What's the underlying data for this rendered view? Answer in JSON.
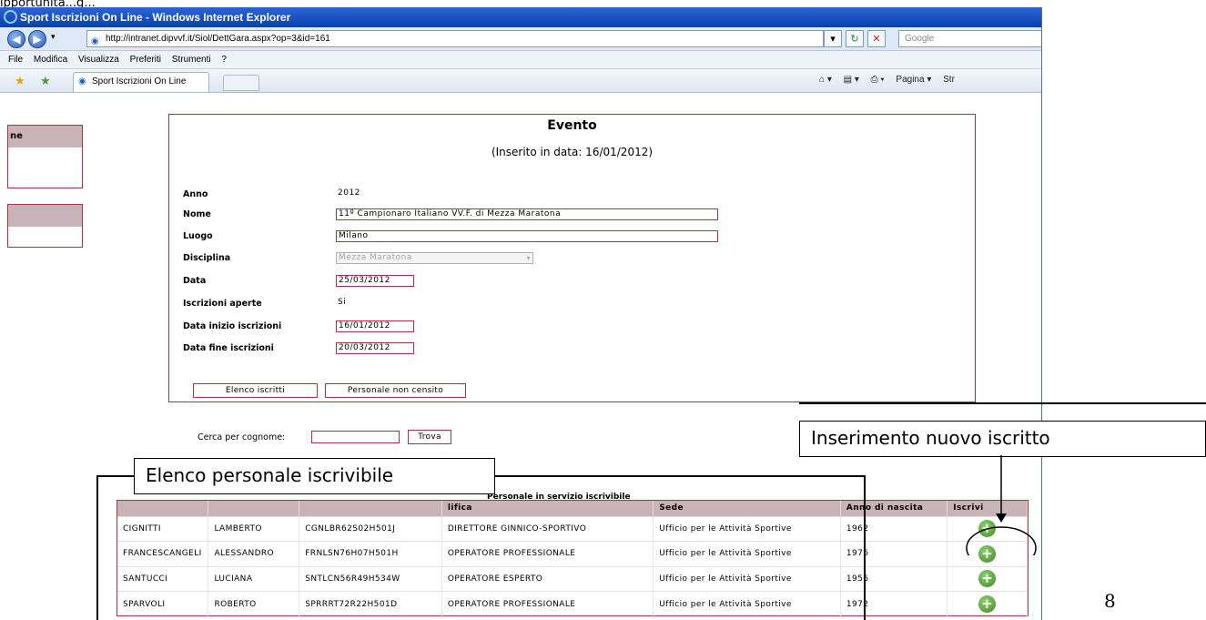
{
  "top_clip_text": "ipportunita...g...",
  "browser": {
    "title": "Sport Iscrizioni On Line - Windows Internet Explorer",
    "address": "http://intranet.dipvvf.it/Siol/DettGara.aspx?op=3&id=161",
    "search_placeholder": "Google",
    "menu": [
      "File",
      "Modifica",
      "Visualizza",
      "Preferiti",
      "Strumenti",
      "?"
    ],
    "tab_label": "Sport Iscrizioni On Line",
    "commands": [
      "Pagina ▾",
      "Str"
    ]
  },
  "sidebar": {
    "box1_header": "ne"
  },
  "event": {
    "title": "Evento",
    "inserted": "(Inserito in data: 16/01/2012)",
    "fields": {
      "anno": {
        "label": "Anno",
        "value": "2012"
      },
      "nome": {
        "label": "Nome",
        "value": "11º Campionaro Italiano VV.F. di Mezza Maratona"
      },
      "luogo": {
        "label": "Luogo",
        "value": "Milano"
      },
      "disciplina": {
        "label": "Disciplina",
        "value": "Mezza Maratona"
      },
      "data": {
        "label": "Data",
        "value": "25/03/2012"
      },
      "iscrizioni_aperte": {
        "label": "Iscrizioni aperte",
        "value": "Si"
      },
      "data_inizio": {
        "label": "Data inizio iscrizioni",
        "value": "16/01/2012"
      },
      "data_fine": {
        "label": "Data fine iscrizioni",
        "value": "20/03/2012"
      }
    },
    "buttons": {
      "elenco": "Elenco iscritti",
      "personale": "Personale non censito"
    }
  },
  "search": {
    "label": "Cerca per cognome:",
    "value": "",
    "button": "Trova"
  },
  "grid": {
    "caption": "Personale in servizio iscrivibile",
    "headers": [
      "",
      "",
      "",
      "lifica",
      "Sede",
      "Anno di nascita",
      "Iscrivi"
    ],
    "rows": [
      [
        "CIGNITTI",
        "LAMBERTO",
        "CGNLBR62S02H501J",
        "DIRETTORE GINNICO-SPORTIVO",
        "Ufficio per le Attività Sportive",
        "1962"
      ],
      [
        "FRANCESCANGELI",
        "ALESSANDRO",
        "FRNLSN76H07H501H",
        "OPERATORE PROFESSIONALE",
        "Ufficio per le Attività Sportive",
        "1976"
      ],
      [
        "SANTUCCI",
        "LUCIANA",
        "SNTLCN56R49H534W",
        "OPERATORE ESPERTO",
        "Ufficio per le Attività Sportive",
        "1956"
      ],
      [
        "SPARVOLI",
        "ROBERTO",
        "SPRRRT72R22H501D",
        "OPERATORE PROFESSIONALE",
        "Ufficio per le Attività Sportive",
        "1972"
      ]
    ],
    "iscrivi_icon": "plus-circle-icon"
  },
  "annotations": {
    "nuovo": "Inserimento nuovo iscritto",
    "elenco": "Elenco personale iscrivibile"
  },
  "slide_number": "8"
}
